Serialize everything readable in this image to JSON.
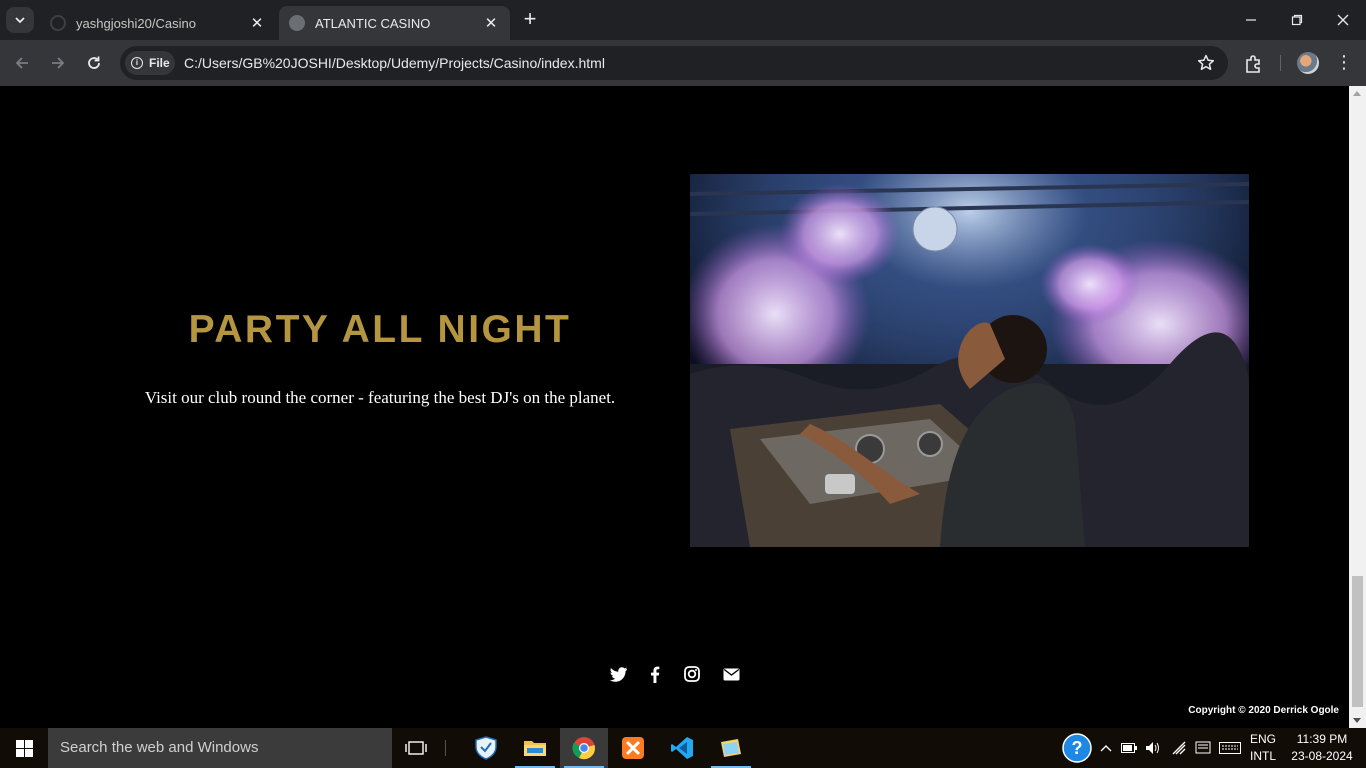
{
  "browser": {
    "tabs": [
      {
        "title": "yashgjoshi20/Casino",
        "active": false
      },
      {
        "title": "ATLANTIC CASINO",
        "active": true
      }
    ],
    "chip_label": "File",
    "url": "C:/Users/GB%20JOSHI/Desktop/Udemy/Projects/Casino/index.html"
  },
  "page": {
    "heading": "PARTY ALL NIGHT",
    "subtext": "Visit our club round the corner - featuring the best DJ's on the planet.",
    "heading_color": "#b5953f",
    "social_icons": [
      "twitter-icon",
      "facebook-icon",
      "instagram-icon",
      "email-icon"
    ],
    "copyright": "Copyright © 2020 Derrick Ogole"
  },
  "taskbar": {
    "search_placeholder": "Search the web and Windows",
    "language_line1": "ENG",
    "language_line2": "INTL",
    "time": "11:39 PM",
    "date": "23-08-2024"
  }
}
